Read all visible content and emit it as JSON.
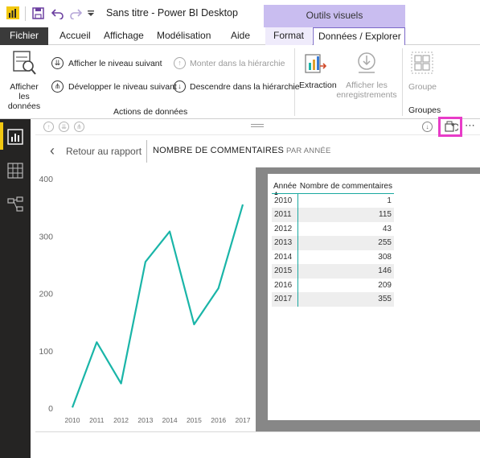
{
  "window": {
    "title": "Sans titre - Power BI Desktop",
    "contextual_header": "Outils visuels"
  },
  "tabs": [
    {
      "label": "Fichier"
    },
    {
      "label": "Accueil"
    },
    {
      "label": "Affichage"
    },
    {
      "label": "Modélisation"
    },
    {
      "label": "Aide"
    },
    {
      "label": "Format"
    },
    {
      "label": "Données / Explorer"
    }
  ],
  "ribbon": {
    "show_data": "Afficher les\ndonnées",
    "show_next_level": "Afficher le niveau suivant",
    "expand_next_level": "Développer le niveau suivant",
    "drill_up": "Monter dans la hiérarchie",
    "drill_down": "Descendre dans la hiérarchie",
    "group_data_actions": "Actions de données",
    "extraction": "Extraction",
    "show_records": "Afficher les\nenregistrements",
    "group": "Groupe",
    "group_groups": "Groupes"
  },
  "focus": {
    "back": "Retour au rapport",
    "title": "NOMBRE DE COMMENTAIRES",
    "subtitle": "PAR ANNÉE"
  },
  "table": {
    "col_year": "Année",
    "col_count": "Nombre de commentaires",
    "rows": [
      {
        "year": "2010",
        "value": "1"
      },
      {
        "year": "2011",
        "value": "115"
      },
      {
        "year": "2012",
        "value": "43"
      },
      {
        "year": "2013",
        "value": "255"
      },
      {
        "year": "2014",
        "value": "308"
      },
      {
        "year": "2015",
        "value": "146"
      },
      {
        "year": "2016",
        "value": "209"
      },
      {
        "year": "2017",
        "value": "355"
      }
    ]
  },
  "colors": {
    "line": "#1ab5a8",
    "accent": "#7b68c8",
    "highlight": "#e83cc8",
    "sidebar": "#252423"
  },
  "chart_data": {
    "type": "line",
    "x": [
      "2010",
      "2011",
      "2012",
      "2013",
      "2014",
      "2015",
      "2016",
      "2017"
    ],
    "series": [
      {
        "values": [
          1,
          115,
          43,
          255,
          308,
          146,
          209,
          355
        ]
      }
    ],
    "yticks": [
      "0",
      "100",
      "200",
      "300",
      "400"
    ],
    "ylim": [
      0,
      400
    ],
    "grid": false
  }
}
